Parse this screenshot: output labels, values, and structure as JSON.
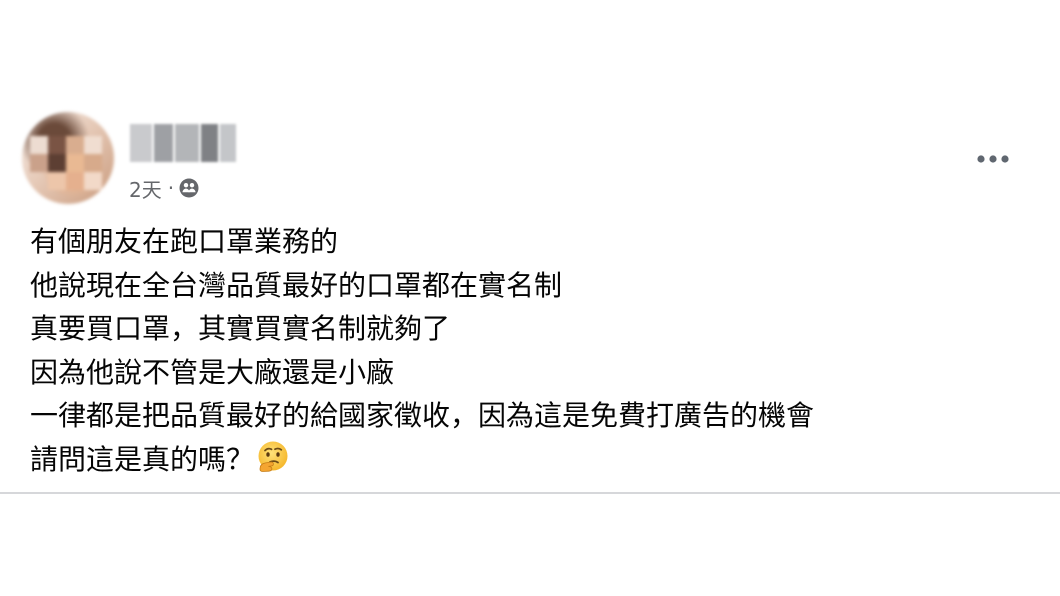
{
  "post": {
    "author": {
      "name": "",
      "avatar_icon": "blurred-profile-photo"
    },
    "meta": {
      "time": "2天",
      "separator": "·",
      "audience_icon": "friends-icon"
    },
    "more_icon": "more-horizontal-icon",
    "body_lines": [
      "有個朋友在跑口罩業務的",
      "他說現在全台灣品質最好的口罩都在實名制",
      "真要買口罩，其實買實名制就夠了",
      "因為他說不管是大廠還是小廠",
      "一律都是把品質最好的給國家徵收，因為這是免費打廣告的機會",
      "請問這是真的嗎？"
    ],
    "trailing_emoji": "thinking-face-emoji"
  },
  "colors": {
    "text": "#050505",
    "secondary_text": "#65676b",
    "divider": "#d6d7da",
    "more_dots": "#606770"
  }
}
